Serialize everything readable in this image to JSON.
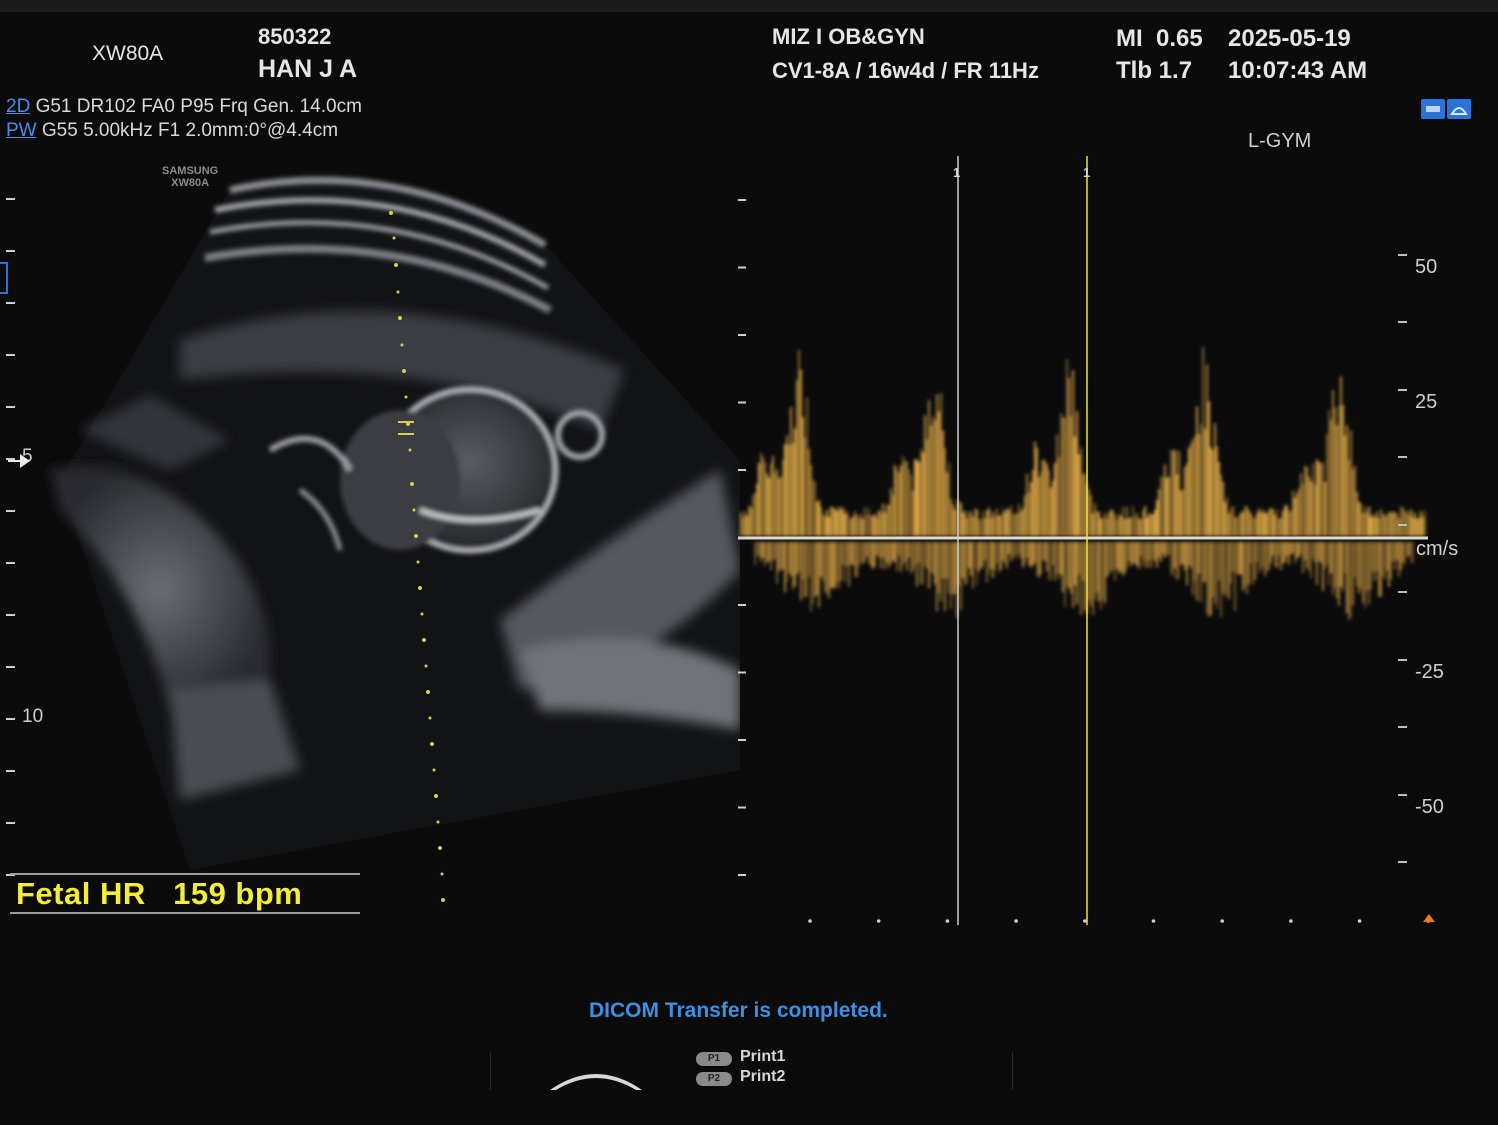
{
  "header": {
    "model": "XW80A",
    "patient_id": "850322",
    "patient_name": "HAN J A",
    "facility": "MIZ I OB&GYN",
    "probe_info": "CV1-8A / 16w4d / FR 11Hz",
    "mi_label": "MI",
    "mi_value": "0.65",
    "tib_label": "Tlb",
    "tib_value": "1.7",
    "date": "2025-05-19",
    "time": "10:07:43 AM"
  },
  "params": {
    "mode_2d": "2D",
    "line_2d": "G51 DR102 FA0 P95 Frq Gen. 14.0cm",
    "mode_pw": "PW",
    "line_pw": "G55 5.00kHz F1  2.0mm:0°@4.4cm"
  },
  "image": {
    "brand_top": "SAMSUNG",
    "brand_bottom": "XW80A",
    "depth_labels": [
      "5",
      "10"
    ]
  },
  "doppler": {
    "preset": "L-GYM",
    "unit": "cm/s",
    "marker_1": "1",
    "marker_2": "1",
    "scale_labels": [
      "50",
      "25",
      "-25",
      "-50"
    ],
    "scale_values": [
      50,
      25,
      -25,
      -50
    ]
  },
  "measurement": {
    "label": "Fetal HR",
    "value": "159 bpm"
  },
  "status": {
    "message": "DICOM Transfer is completed."
  },
  "footer": {
    "p1_badge": "P1",
    "p1_label": "Print1",
    "p2_badge": "P2",
    "p2_label": "Print2"
  },
  "colors": {
    "doppler_gold": "#e8b048",
    "measure_yellow": "#f4ec3a",
    "status_blue": "#3f8fe3"
  }
}
